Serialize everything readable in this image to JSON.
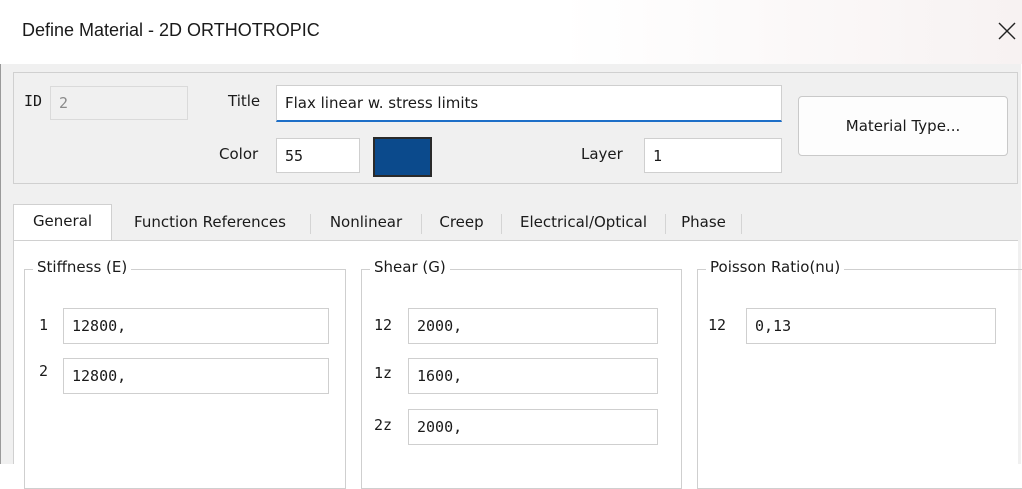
{
  "window": {
    "title": "Define Material - 2D ORTHOTROPIC"
  },
  "header": {
    "id_label": "ID",
    "id_value": "2",
    "title_label": "Title",
    "title_value": "Flax linear w. stress limits",
    "color_label": "Color",
    "color_value": "55",
    "color_swatch": "#0b4a8c",
    "layer_label": "Layer",
    "layer_value": "1",
    "material_type_button": "Material Type..."
  },
  "tabs": [
    {
      "label": "General",
      "active": true
    },
    {
      "label": "Function References",
      "active": false
    },
    {
      "label": "Nonlinear",
      "active": false
    },
    {
      "label": "Creep",
      "active": false
    },
    {
      "label": "Electrical/Optical",
      "active": false
    },
    {
      "label": "Phase",
      "active": false
    }
  ],
  "general": {
    "stiffness": {
      "legend": "Stiffness (E)",
      "rows": [
        {
          "label": "1",
          "value": "12800,"
        },
        {
          "label": "2",
          "value": "12800,"
        }
      ]
    },
    "shear": {
      "legend": "Shear (G)",
      "rows": [
        {
          "label": "12",
          "value": "2000,"
        },
        {
          "label": "1z",
          "value": "1600,"
        },
        {
          "label": "2z",
          "value": "2000,"
        }
      ]
    },
    "poisson": {
      "legend": "Poisson Ratio(nu)",
      "rows": [
        {
          "label": "12",
          "value": "0,13"
        }
      ]
    }
  },
  "icons": {
    "close": "close-icon"
  }
}
